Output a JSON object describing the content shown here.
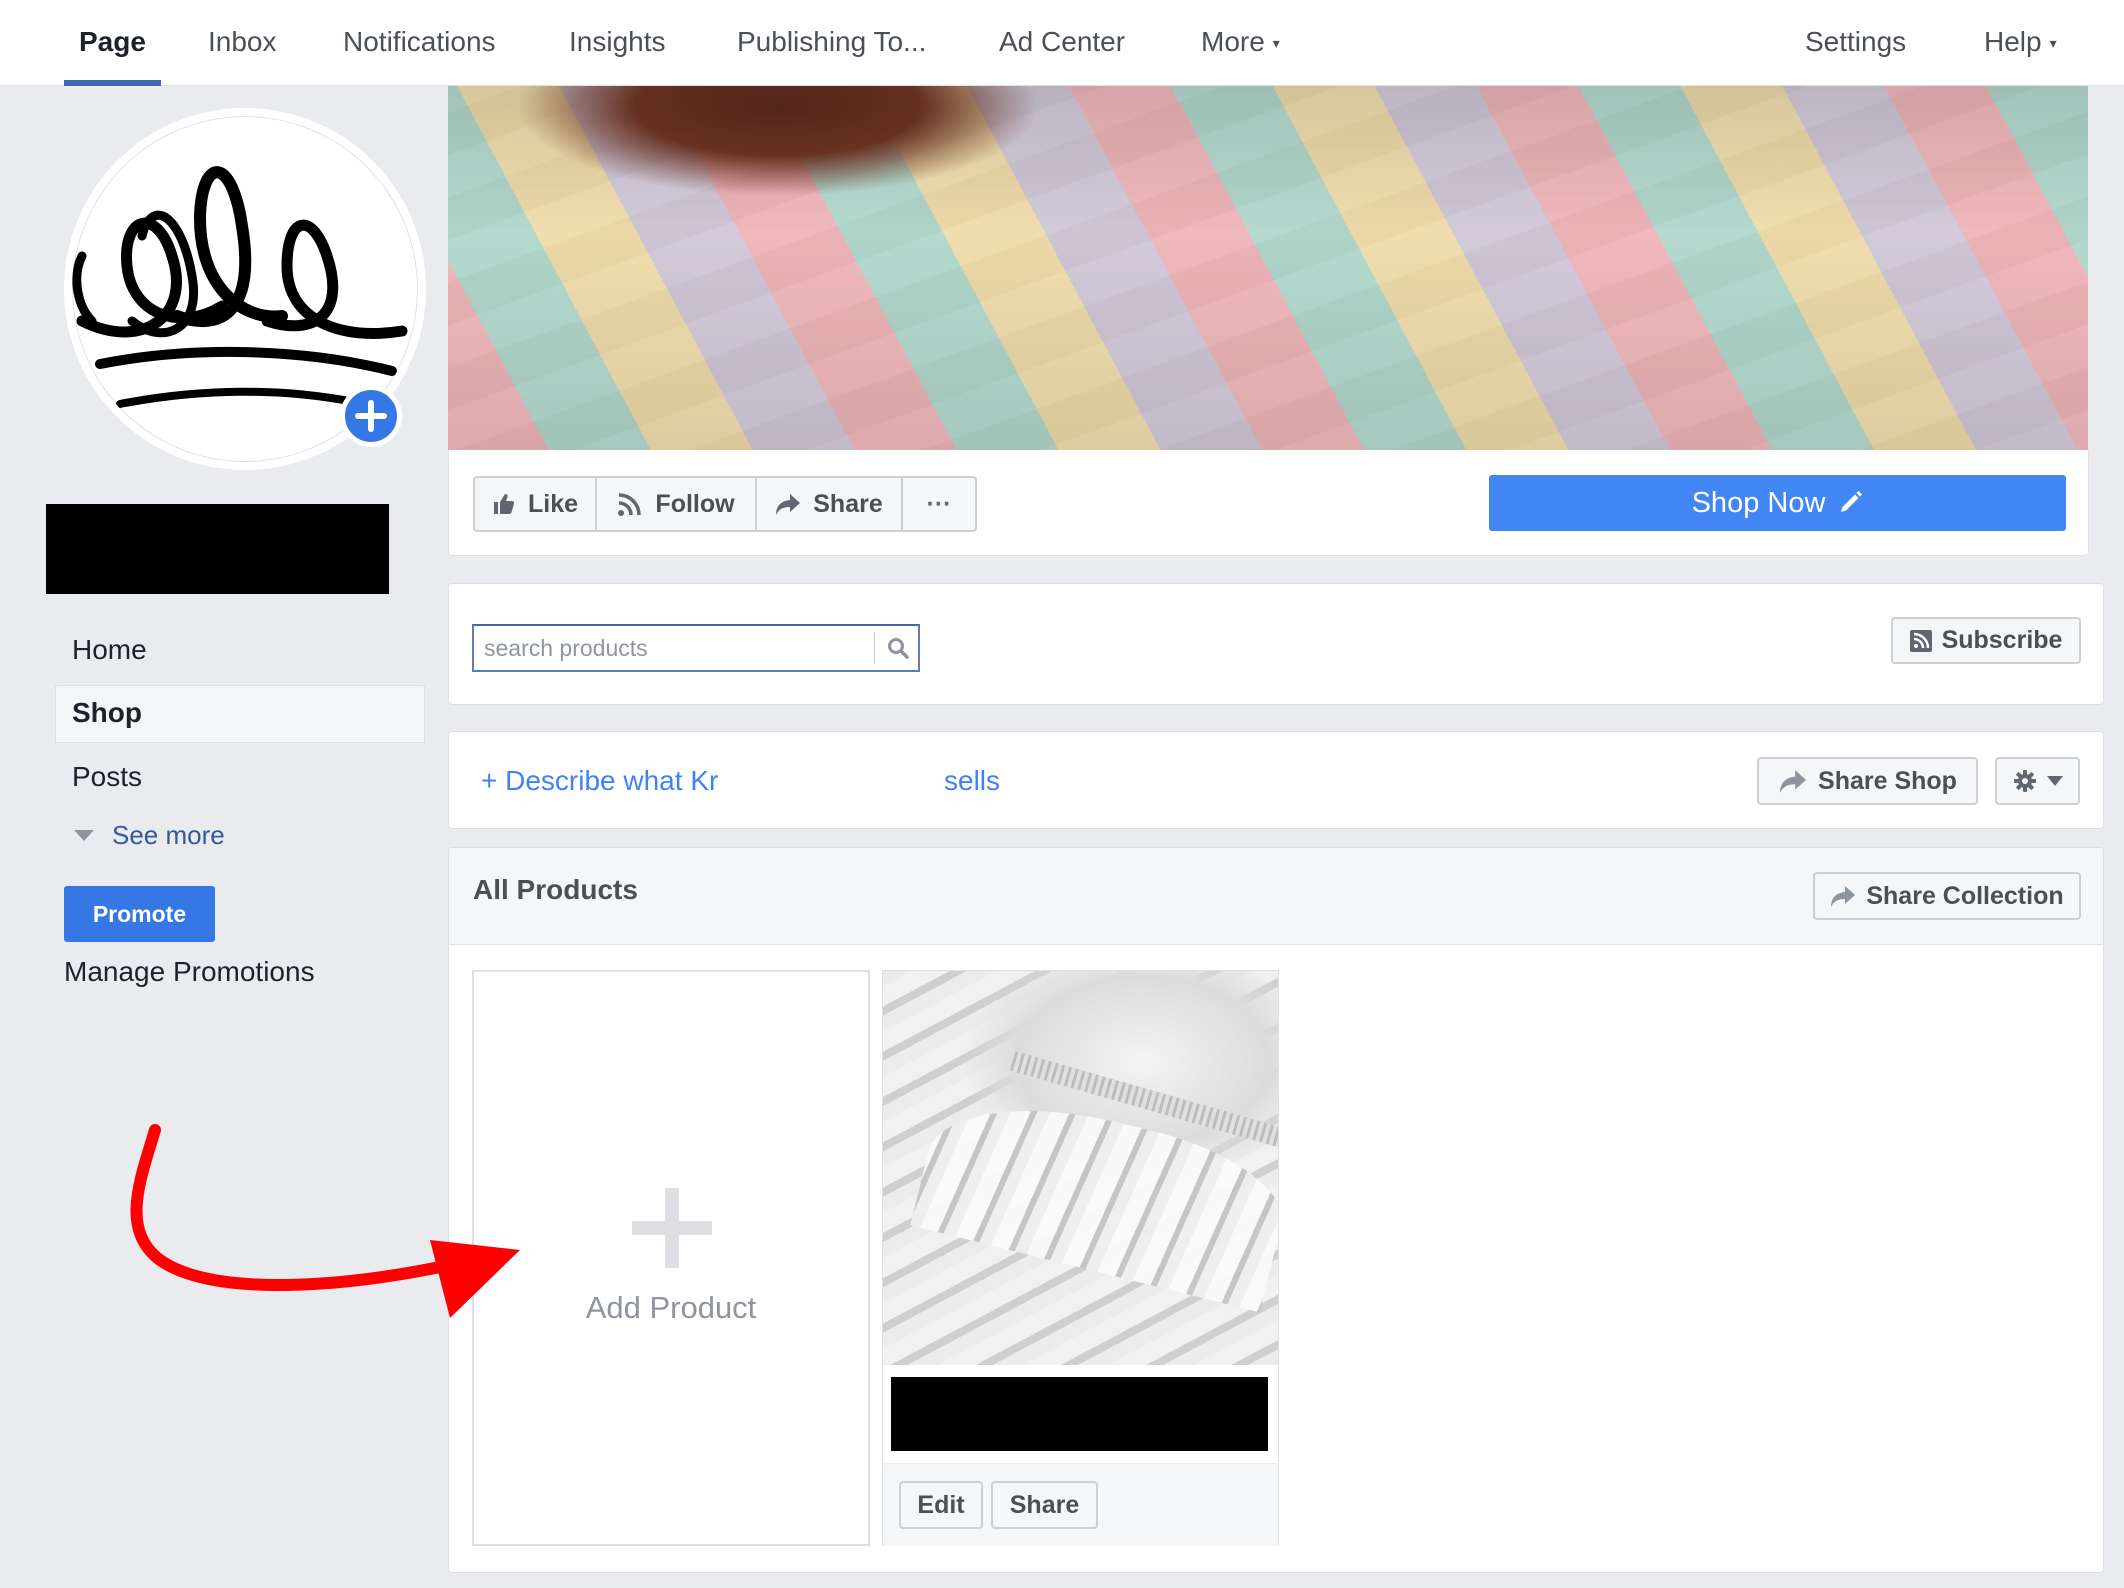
{
  "topnav": {
    "items": [
      {
        "label": "Page",
        "active": true
      },
      {
        "label": "Inbox"
      },
      {
        "label": "Notifications"
      },
      {
        "label": "Insights"
      },
      {
        "label": "Publishing To..."
      },
      {
        "label": "Ad Center"
      },
      {
        "label": "More",
        "has_caret": true
      }
    ],
    "right_items": [
      {
        "label": "Settings"
      },
      {
        "label": "Help",
        "has_caret": true
      }
    ],
    "caret_glyph": "▾",
    "accent_color": "#4267b2"
  },
  "sidebar": {
    "page_name": "[redacted]",
    "avatar_icon": "crown-logo",
    "avatar_add_icon": "plus-circle-icon",
    "items": [
      {
        "label": "Home"
      },
      {
        "label": "Shop",
        "active": true
      },
      {
        "label": "Posts"
      }
    ],
    "see_more": "See more",
    "promote_label": "Promote",
    "manage_promotions": "Manage Promotions"
  },
  "actions": {
    "like": "Like",
    "follow": "Follow",
    "share": "Share",
    "more": "···",
    "cta": "Shop Now",
    "cta_color": "#4286f4"
  },
  "shop": {
    "search_placeholder": "search products",
    "search_value": "",
    "subscribe": "Subscribe",
    "describe_prefix": "+ Describe what Kr",
    "describe_suffix": "sells",
    "share_shop": "Share Shop",
    "collection_title": "All Products",
    "share_collection": "Share Collection",
    "add_product": "Add Product",
    "products": [
      {
        "name": "[redacted]",
        "edit_label": "Edit",
        "share_label": "Share"
      }
    ]
  },
  "annotation": {
    "type": "red-arrow",
    "color": "#ff0000",
    "points_to": "Add Product"
  }
}
